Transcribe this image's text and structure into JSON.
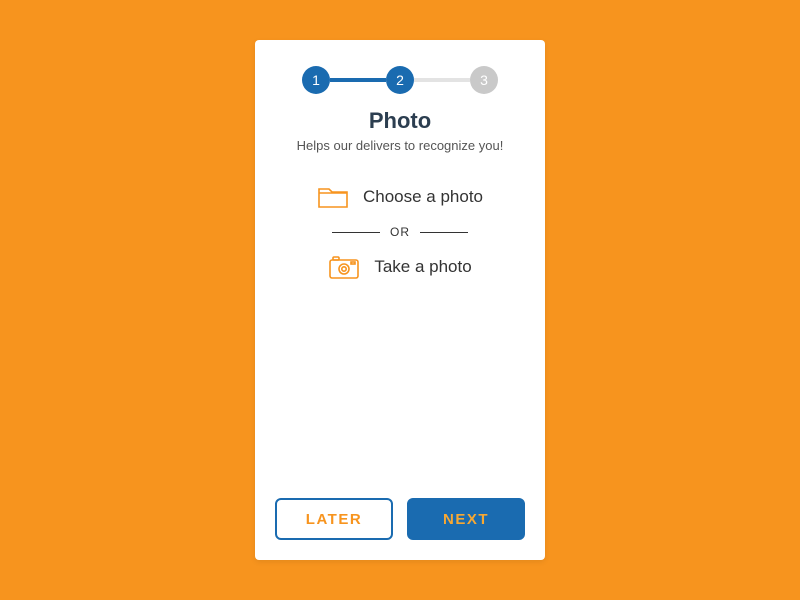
{
  "progress": {
    "steps": [
      "1",
      "2",
      "3"
    ],
    "current": 2
  },
  "title": "Photo",
  "subtitle": "Helps our delivers to recognize you!",
  "options": {
    "choose_label": "Choose a photo",
    "or_label": "OR",
    "take_label": "Take a photo"
  },
  "buttons": {
    "later": "LATER",
    "next": "NEXT"
  },
  "colors": {
    "bg": "#F7941E",
    "primary": "#1A6BB0",
    "accent": "#F7941E",
    "inactive": "#C9C9C9"
  }
}
